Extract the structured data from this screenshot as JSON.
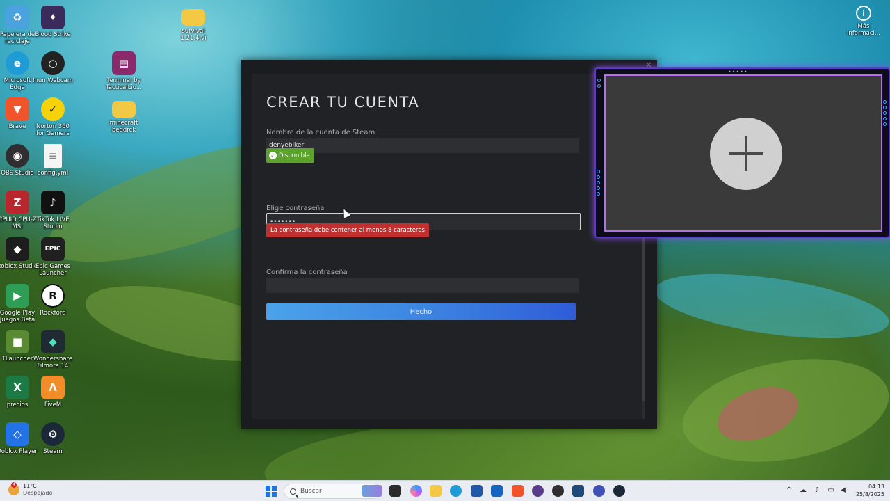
{
  "desktop": {
    "icons": [
      {
        "label": "Papelera de reciclaje",
        "icon": "recycle-bin-icon",
        "color": "#4aa3df"
      },
      {
        "label": "Blood Strike",
        "icon": "blood-strike-icon",
        "color": "#3b2a5c"
      },
      {
        "label": "survival 1.21.4.vi",
        "icon": "folder-icon",
        "color": "#f3c845"
      },
      {
        "label": "Microsoft Edge",
        "icon": "edge-icon",
        "color": "#1f9bd6"
      },
      {
        "label": "Inun Webcam",
        "icon": "webcam-icon",
        "color": "#222222"
      },
      {
        "label": "Terminal by TacticalLio...",
        "icon": "winrar-icon",
        "color": "#8a2a6a"
      },
      {
        "label": "Brave",
        "icon": "brave-icon",
        "color": "#f1542b"
      },
      {
        "label": "Norton 360 for Gamers",
        "icon": "norton-icon",
        "color": "#f5d20a"
      },
      {
        "label": "minecraft beddrck",
        "icon": "folder-icon",
        "color": "#f3c845"
      },
      {
        "label": "OBS Studio",
        "icon": "obs-icon",
        "color": "#302e31"
      },
      {
        "label": "config.yml",
        "icon": "file-icon",
        "color": "#f5f5f5"
      },
      {
        "label": "CPUID CPU-Z MSI",
        "icon": "cpuz-icon",
        "color": "#b8272d"
      },
      {
        "label": "TikTok LIVE Studio",
        "icon": "tiktok-icon",
        "color": "#111111"
      },
      {
        "label": "Roblox Studio",
        "icon": "roblox-studio-icon",
        "color": "#1d1d1d"
      },
      {
        "label": "Epic Games Launcher",
        "icon": "epic-games-icon",
        "color": "#202020"
      },
      {
        "label": "Google Play Juegos Beta",
        "icon": "google-play-games-icon",
        "color": "#2e9e57"
      },
      {
        "label": "Rockford",
        "icon": "rockford-icon",
        "color": "#ffffff"
      },
      {
        "label": "TLauncher",
        "icon": "tlauncher-icon",
        "color": "#5b8a34"
      },
      {
        "label": "Wondershare Filmora 14",
        "icon": "filmora-icon",
        "color": "#1f2a32"
      },
      {
        "label": "precios",
        "icon": "excel-icon",
        "color": "#1e7a44"
      },
      {
        "label": "FiveM",
        "icon": "fivem-icon",
        "color": "#f28c28"
      },
      {
        "label": "Roblox Player",
        "icon": "roblox-player-icon",
        "color": "#2473e6"
      },
      {
        "label": "Steam",
        "icon": "steam-icon",
        "color": "#1b2838"
      },
      {
        "label": "Más informaci...",
        "icon": "info-icon",
        "color": "#555555"
      }
    ]
  },
  "steam_dialog": {
    "title": "CREAR TU CUENTA",
    "account_label": "Nombre de la cuenta de Steam",
    "account_value": "denyebiker",
    "available_badge": "Disponible",
    "password_label": "Elige contraseña",
    "password_value": "•••••••",
    "password_error": "La contraseña debe contener al menos 8 caracteres",
    "confirm_label": "Confirma la contraseña",
    "confirm_value": "",
    "done_button": "Hecho",
    "close_glyph": "×"
  },
  "webcam_overlay": {
    "add_icon": "plus-icon",
    "dots": "•••••"
  },
  "taskbar": {
    "weather_temp": "11°C",
    "weather_desc": "Despejado",
    "weather_badge": "4",
    "search_placeholder": "Buscar",
    "time": "04:13",
    "date": "25/8/2025"
  }
}
